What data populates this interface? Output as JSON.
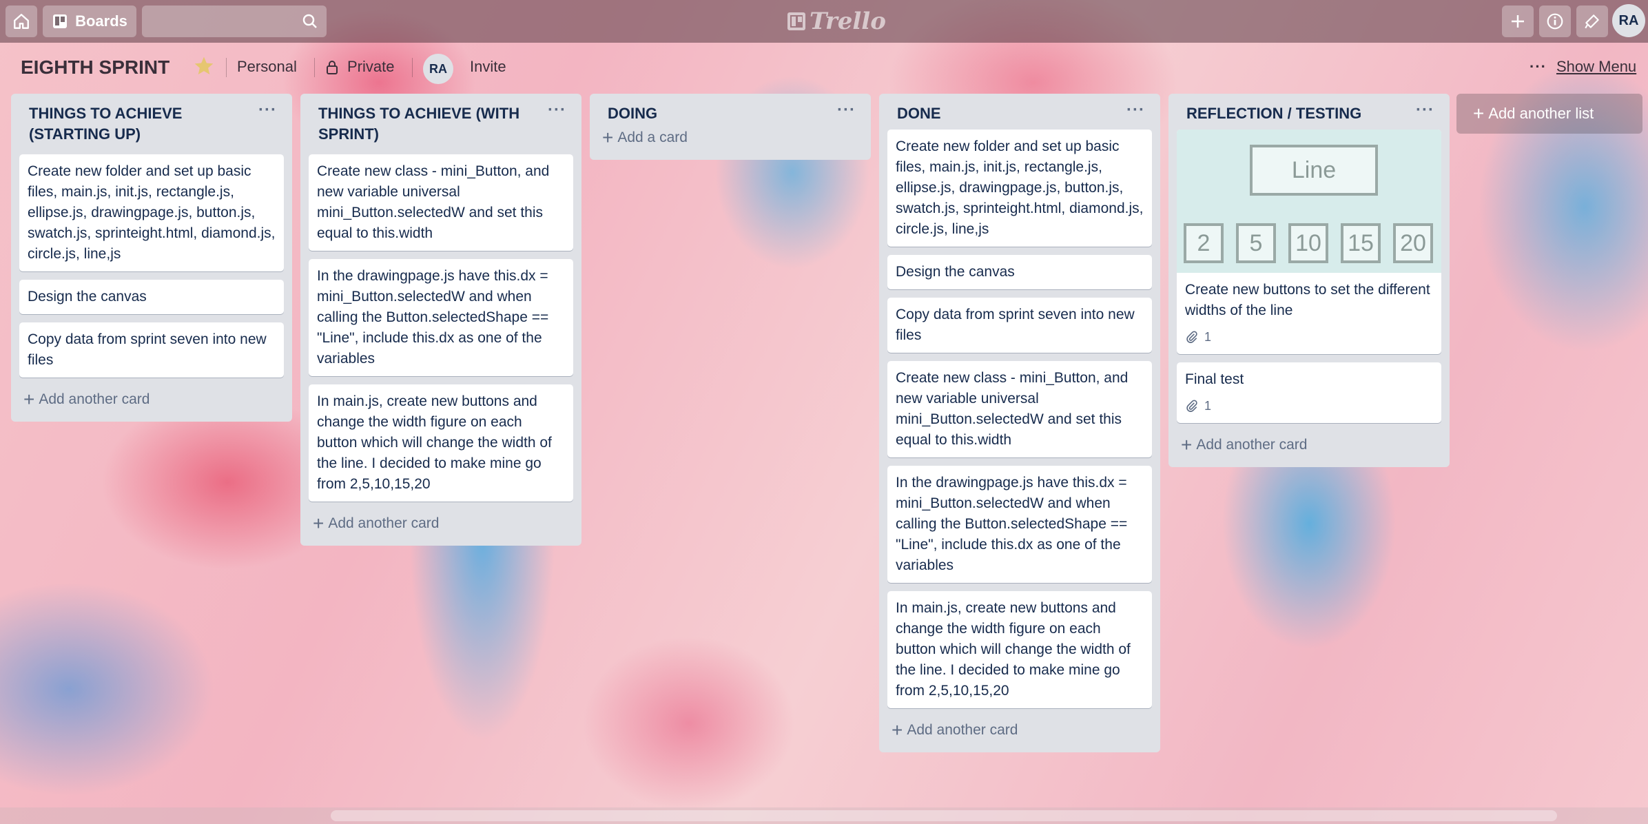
{
  "header": {
    "boards_label": "Boards",
    "search_placeholder": "",
    "logo_text": "Trello",
    "user_initials": "RA"
  },
  "board": {
    "title": "EIGHTH SPRINT",
    "team": "Personal",
    "visibility": "Private",
    "member_initials": "RA",
    "invite_label": "Invite",
    "show_menu_dots": "···",
    "show_menu_label": "Show Menu",
    "add_list_label": "Add another list"
  },
  "lists": [
    {
      "title": "THINGS TO ACHIEVE (STARTING UP)",
      "cards": [
        "Create new folder and set up basic files, main.js, init.js, rectangle.js, ellipse.js, drawingpage.js, button.js, swatch.js, sprinteight.html, diamond.js, circle.js, line,js",
        "Design the canvas",
        "Copy data from sprint seven into new files"
      ],
      "add_card": "Add another card"
    },
    {
      "title": "THINGS TO ACHIEVE (WITH SPRINT)",
      "cards": [
        "Create new class - mini_Button, and new variable universal mini_Button.selectedW and set this equal to this.width",
        "In the drawingpage.js have this.dx = mini_Button.selectedW and when calling the Button.selectedShape == \"Line\", include this.dx as one of the variables",
        "In main.js, create new buttons and change the width figure on each button which will change the width of the line. I decided to make mine go from 2,5,10,15,20"
      ],
      "add_card": "Add another card"
    },
    {
      "title": "DOING",
      "cards": [],
      "add_card": "Add a card"
    },
    {
      "title": "DONE",
      "cards": [
        "Create new folder and set up basic files, main.js, init.js, rectangle.js, ellipse.js, drawingpage.js, button.js, swatch.js, sprinteight.html, diamond.js, circle.js, line,js",
        "Design the canvas",
        "Copy data from sprint seven into new files",
        "Create new class - mini_Button, and new variable universal mini_Button.selectedW and set this equal to this.width",
        "In the drawingpage.js have this.dx = mini_Button.selectedW and when calling the Button.selectedShape == \"Line\", include this.dx as one of the variables",
        "In main.js, create new buttons and change the width figure on each button which will change the width of the line. I decided to make mine go from 2,5,10,15,20"
      ],
      "add_card": "Add another card"
    },
    {
      "title": "REFLECTION / TESTING",
      "cover": {
        "line_label": "Line",
        "widths": [
          "2",
          "5",
          "10",
          "15",
          "20"
        ]
      },
      "cards": [
        {
          "text": "Create new buttons to set the different widths of the line",
          "attachments": "1"
        },
        {
          "text": "Final test",
          "attachments": "1"
        }
      ],
      "add_card": "Add another card"
    }
  ],
  "icons": {
    "home": "home-icon",
    "boards": "boards-icon",
    "search": "search-icon",
    "add": "plus-icon",
    "info": "info-icon",
    "notifications": "megaphone-icon",
    "star": "star-icon",
    "lock": "lock-icon",
    "attachment": "paperclip-icon"
  }
}
